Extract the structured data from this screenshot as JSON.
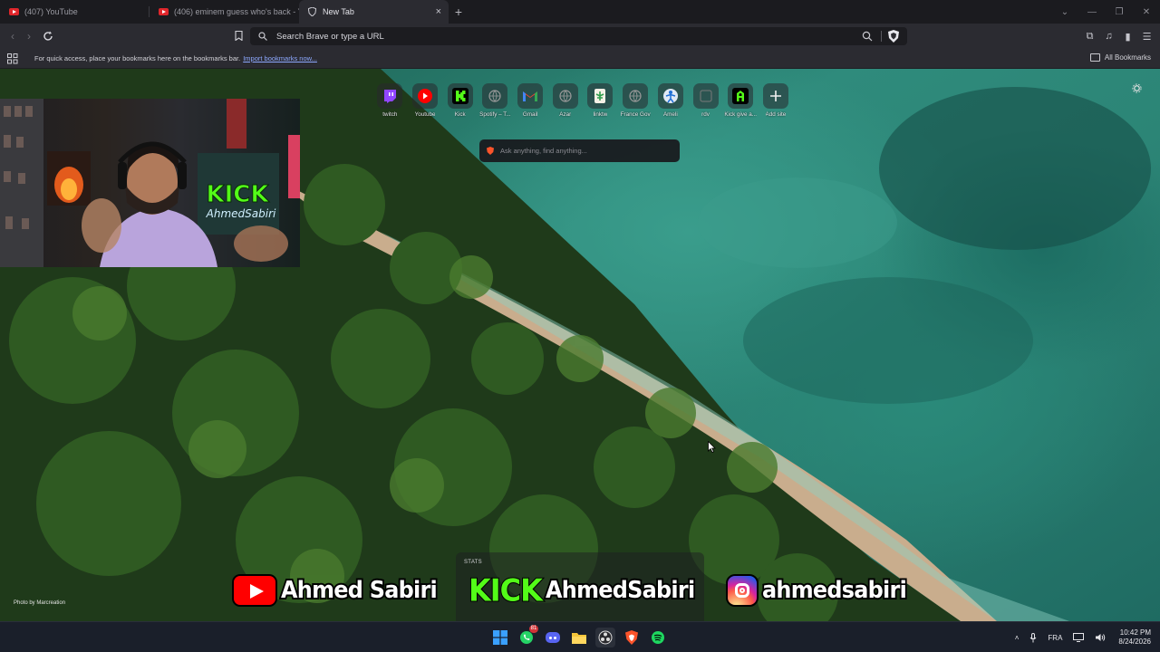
{
  "browser": {
    "tabs": [
      {
        "title": "(407) YouTube",
        "active": false,
        "icon": "youtube-icon"
      },
      {
        "title": "(406) eminem guess who's back - Yo",
        "active": false,
        "icon": "youtube-icon"
      },
      {
        "title": "New Tab",
        "active": true,
        "icon": "brave-shield-icon"
      }
    ],
    "new_tab_symbol": "+",
    "close_symbol": "×",
    "omnibox_text": "Search Brave or type a URL",
    "bookmarks_message": "For quick access, place your bookmarks here on the bookmarks bar.",
    "import_link": "Import bookmarks now...",
    "all_bookmarks": "All Bookmarks"
  },
  "new_tab_page": {
    "top_sites": [
      {
        "label": "twitch",
        "icon": "twitch-icon",
        "color": "#9146ff"
      },
      {
        "label": "Youtube",
        "icon": "youtube-icon",
        "color": "#ff0000"
      },
      {
        "label": "Kick",
        "icon": "kick-icon",
        "color": "#53fc18"
      },
      {
        "label": "Spotify – T...",
        "icon": "blank-site-icon",
        "color": "#8a8a8a"
      },
      {
        "label": "Gmail",
        "icon": "gmail-icon",
        "color": "#ea4335"
      },
      {
        "label": "Azar",
        "icon": "blank-site-icon",
        "color": "#8a8a8a"
      },
      {
        "label": "linktw",
        "icon": "linktree-icon",
        "color": "#43e660"
      },
      {
        "label": "France Gov",
        "icon": "blank-site-icon",
        "color": "#8a8a8a"
      },
      {
        "label": "Ameli",
        "icon": "ameli-icon",
        "color": "#1f6fd6"
      },
      {
        "label": "rdv",
        "icon": "blank-site-icon",
        "color": "#8a8a8a"
      },
      {
        "label": "Kick give a...",
        "icon": "kick-a-icon",
        "color": "#53fc18"
      },
      {
        "label": "Add site",
        "icon": "plus-icon",
        "color": "#ffffff"
      }
    ],
    "search_placeholder": "Ask anything, find anything...",
    "stats_title": "STATS",
    "photo_credit": "Photo by Marcreation"
  },
  "stream_overlay": {
    "youtube_name": "Ahmed Sabiri",
    "kick_logo": "KICK",
    "kick_name": "AhmedSabiri",
    "instagram_name": "ahmedsabiri"
  },
  "taskbar": {
    "apps": [
      {
        "name": "windows-start-icon"
      },
      {
        "name": "whatsapp-icon",
        "badge": "81"
      },
      {
        "name": "discord-icon"
      },
      {
        "name": "file-explorer-icon"
      },
      {
        "name": "obs-icon"
      },
      {
        "name": "brave-browser-icon"
      },
      {
        "name": "spotify-icon"
      }
    ],
    "language": "FRA",
    "time": "10:42 PM",
    "date": "8/24/2026"
  }
}
